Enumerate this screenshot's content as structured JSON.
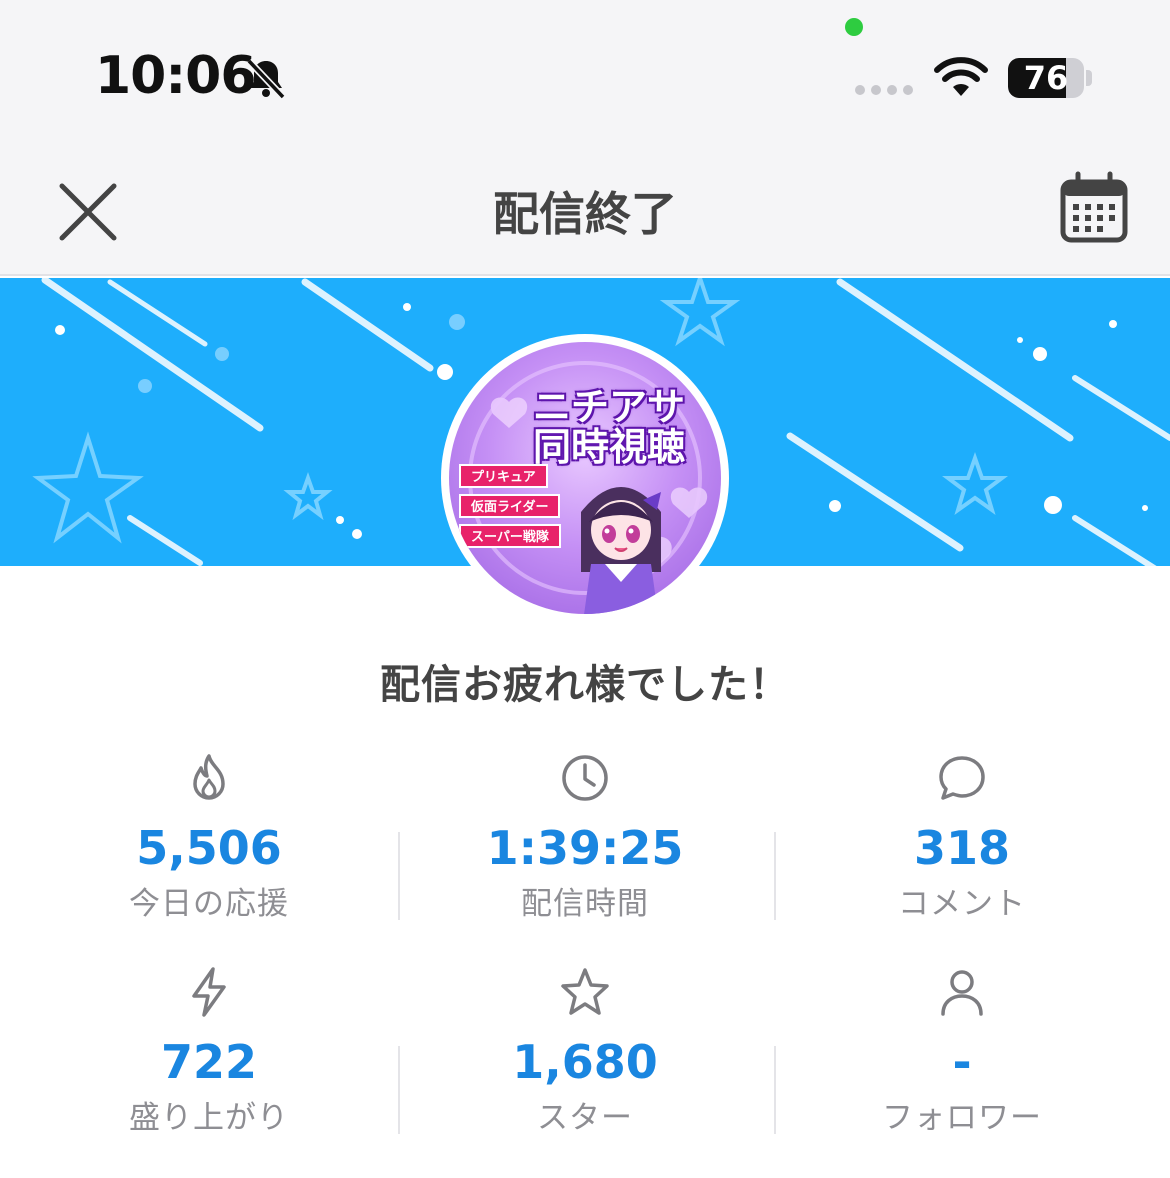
{
  "status_bar": {
    "time": "10:06",
    "battery": "76",
    "battery_level": 0.76
  },
  "header": {
    "title": "配信終了"
  },
  "thumbnail": {
    "title_line1": "ニチアサ",
    "title_line2": "同時視聴",
    "tags": [
      "プリキュア",
      "仮面ライダー",
      "スーパー戦隊"
    ]
  },
  "message": "配信お疲れ様でした！",
  "stats": [
    {
      "icon": "flame-icon",
      "value": "5,506",
      "label": "今日の応援"
    },
    {
      "icon": "clock-icon",
      "value": "1:39:25",
      "label": "配信時間"
    },
    {
      "icon": "comment-icon",
      "value": "318",
      "label": "コメント"
    },
    {
      "icon": "lightning-icon",
      "value": "722",
      "label": "盛り上がり"
    },
    {
      "icon": "star-icon",
      "value": "1,680",
      "label": "スター"
    },
    {
      "icon": "person-icon",
      "value": "-",
      "label": "フォロワー"
    }
  ],
  "colors": {
    "banner": "#1eaefc",
    "accent": "#1a86e0",
    "icon_gray": "#7c7c80"
  }
}
